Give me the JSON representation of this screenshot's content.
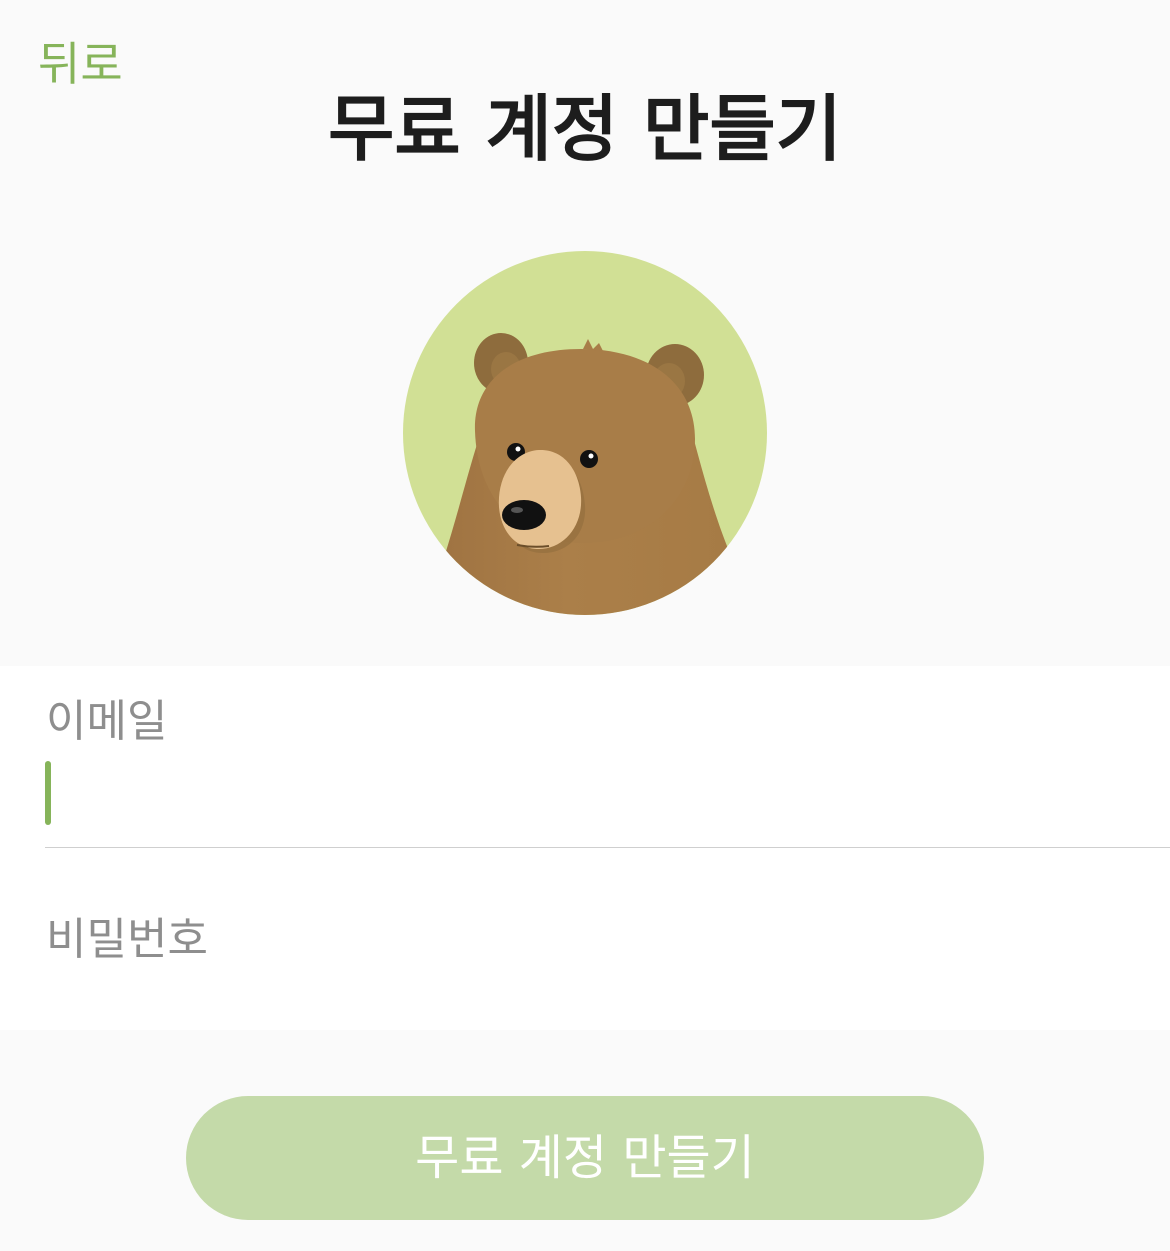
{
  "header": {
    "back_label": "뒤로",
    "title": "무료 계정 만들기"
  },
  "avatar": {
    "icon": "bear-mascot-icon",
    "background_color": "#d1e095",
    "fur_color": "#a87d48"
  },
  "form": {
    "email_label": "이메일",
    "email_value": "",
    "password_label": "비밀번호",
    "password_value": ""
  },
  "submit": {
    "label": "무료 계정 만들기",
    "enabled": false
  },
  "colors": {
    "accent": "#86b45a",
    "button_disabled": "#c4daa9",
    "page_background": "#fafafa"
  }
}
